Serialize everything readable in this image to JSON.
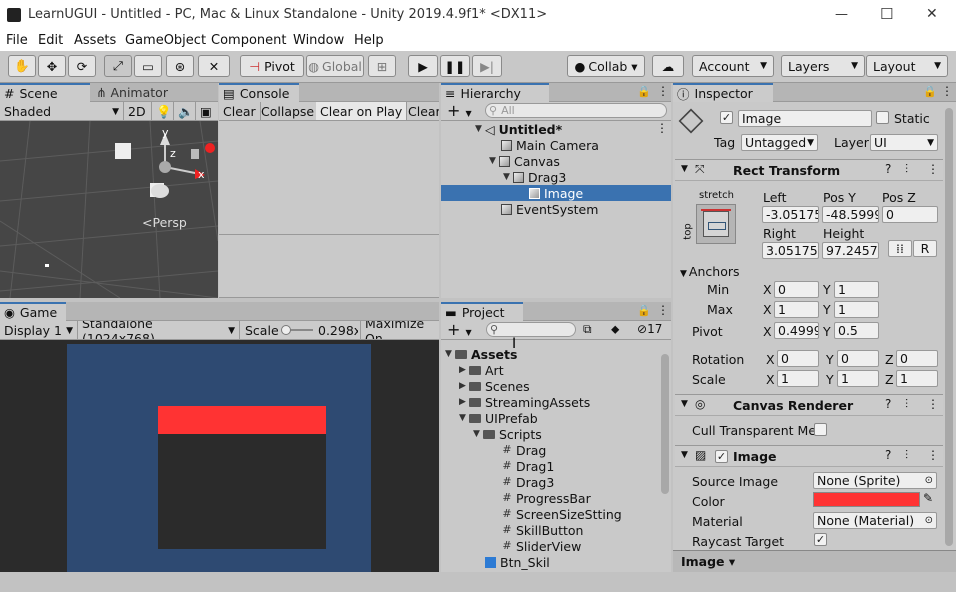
{
  "window": {
    "title": "LearnUGUI - Untitled - PC, Mac & Linux Standalone - Unity 2019.4.9f1* <DX11>",
    "min": "—",
    "max": "☐",
    "close": "✕"
  },
  "menu": [
    "File",
    "Edit",
    "Assets",
    "GameObject",
    "Component",
    "Window",
    "Help"
  ],
  "toolbar": {
    "pivot": "Pivot",
    "global": "Global",
    "collab": "Collab ▾",
    "account": "Account",
    "layers": "Layers",
    "layout": "Layout"
  },
  "scene": {
    "tab_scene": "Scene",
    "tab_animator": "Animator",
    "shading": "Shaded",
    "mode2d": "2D",
    "persp": "<Persp",
    "axis_y": "y",
    "axis_z": "z",
    "axis_x": "x"
  },
  "console": {
    "tab": "Console",
    "clear": "Clear",
    "collapse": "Collapse",
    "clear_on_play": "Clear on Play",
    "clear2": "Clear"
  },
  "hierarchy": {
    "tab": "Hierarchy",
    "search_placeholder": "All",
    "items": [
      "Untitled*",
      "Main Camera",
      "Canvas",
      "Drag3",
      "Image",
      "EventSystem"
    ]
  },
  "game": {
    "tab": "Game",
    "display": "Display 1",
    "resolution": "Standalone (1024x768)",
    "scale_label": "Scale",
    "scale_value": "0.298x",
    "maximize": "Maximize On"
  },
  "project": {
    "tab": "Project",
    "count": "17",
    "items": [
      "Assets",
      "Art",
      "Scenes",
      "StreamingAssets",
      "UIPrefab",
      "Scripts",
      "Drag",
      "Drag1",
      "Drag3",
      "ProgressBar",
      "ScreenSizeStting",
      "SkillButton",
      "SliderView",
      "Btn_Skil"
    ]
  },
  "inspector": {
    "tab": "Inspector",
    "name": "Image",
    "static": "Static",
    "tag_label": "Tag",
    "tag_value": "Untagged",
    "layer_label": "Layer",
    "layer_value": "UI",
    "rect_transform": "Rect Transform",
    "stretch": "stretch",
    "top": "top",
    "left_label": "Left",
    "left": "-3.05175",
    "posy_label": "Pos Y",
    "posy": "-48.5999",
    "posz_label": "Pos Z",
    "posz": "0",
    "right_label": "Right",
    "right": "3.051758",
    "height_label": "Height",
    "height": "97.24573",
    "r_btn": "R",
    "anchors": "Anchors",
    "min": "Min",
    "max": "Max",
    "pivot": "Pivot",
    "x": "X",
    "y": "Y",
    "z": "Z",
    "min_x": "0",
    "min_y": "1",
    "max_x": "1",
    "max_y": "1",
    "pivot_x": "0.4999",
    "pivot_y": "0.5",
    "rotation": "Rotation",
    "rot_x": "0",
    "rot_y": "0",
    "rot_z": "0",
    "scale": "Scale",
    "sc_x": "1",
    "sc_y": "1",
    "sc_z": "1",
    "canvas_renderer": "Canvas Renderer",
    "cull": "Cull Transparent Mes",
    "image_comp": "Image",
    "source_image_label": "Source Image",
    "source_image": "None (Sprite)",
    "color_label": "Color",
    "color_value": "#ff3333",
    "material_label": "Material",
    "material": "None (Material)",
    "raycast_label": "Raycast Target",
    "footer": "Image ▾"
  }
}
